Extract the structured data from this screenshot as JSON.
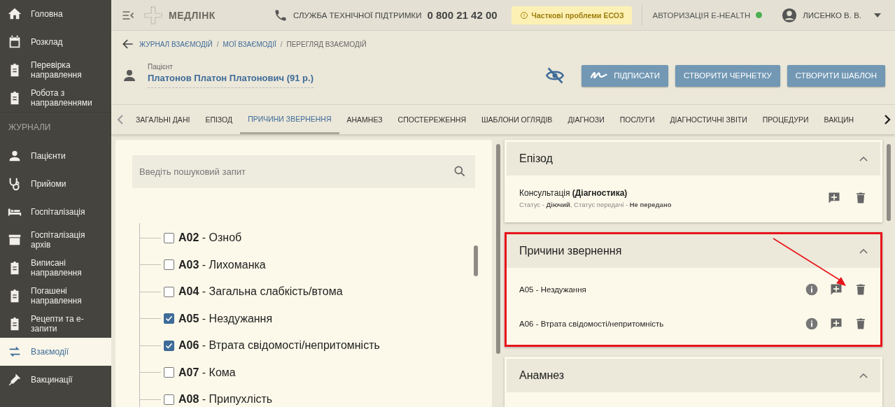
{
  "sidebar": {
    "items": [
      {
        "label": "Головна",
        "selected": false
      },
      {
        "label": "Розклад",
        "selected": false
      },
      {
        "label": "Перевірка направлення",
        "selected": false
      },
      {
        "label": "Робота з направленнями",
        "selected": false
      }
    ],
    "section_title": "ЖУРНАЛИ",
    "journal_items": [
      {
        "label": "Пацієнти",
        "selected": false
      },
      {
        "label": "Прийоми",
        "selected": false
      },
      {
        "label": "Госпіталізація",
        "selected": false
      },
      {
        "label": "Госпіталізація архів",
        "selected": false
      },
      {
        "label": "Виписані направлення",
        "selected": false
      },
      {
        "label": "Погашені направлення",
        "selected": false
      },
      {
        "label": "Рецепти та е-запити",
        "selected": false
      },
      {
        "label": "Взаємодії",
        "selected": true
      },
      {
        "label": "Вакцинації",
        "selected": false
      }
    ]
  },
  "header": {
    "logo": "МЕДЛІНК",
    "support_label": "СЛУЖБА ТЕХНІЧНОЇ ПІДТРИМКИ",
    "support_phone": "0 800 21 42 00",
    "warning": "Часткові проблеми ЕСОЗ",
    "auth_label": "АВТОРИЗАЦІЯ E-HEALTH",
    "user": "ЛИСЕНКО В. В."
  },
  "breadcrumbs": [
    "ЖУРНАЛ ВЗАЄМОДІЙ",
    "МОЇ ВЗАЄМОДІЇ",
    "ПЕРЕГЛЯД ВЗАЄМОДІЙ"
  ],
  "breadcrumb_separator": "/",
  "patient": {
    "label": "Пацієнт",
    "name": "Платонов Платон Платонович (91 р.)"
  },
  "actions": [
    "ПІДПИСАТИ",
    "СТВОРИТИ ЧЕРНЕТКУ",
    "СТВОРИТИ ШАБЛОН"
  ],
  "tabs": [
    {
      "label": "ЗАГАЛЬНІ ДАНІ",
      "selected": false
    },
    {
      "label": "ЕПІЗОД",
      "selected": false
    },
    {
      "label": "ПРИЧИНИ ЗВЕРНЕННЯ",
      "selected": true
    },
    {
      "label": "АНАМНЕЗ",
      "selected": false
    },
    {
      "label": "СПОСТЕРЕЖЕННЯ",
      "selected": false
    },
    {
      "label": "ШАБЛОНИ ОГЛЯДІВ",
      "selected": false
    },
    {
      "label": "ДІАГНОЗИ",
      "selected": false
    },
    {
      "label": "ПОСЛУГИ",
      "selected": false
    },
    {
      "label": "ДІАГНОСТИЧНІ ЗВІТИ",
      "selected": false
    },
    {
      "label": "ПРОЦЕДУРИ",
      "selected": false
    },
    {
      "label": "ВАКЦИН",
      "selected": false
    }
  ],
  "search": {
    "placeholder": "Введіть пошуковий запит"
  },
  "tree": [
    {
      "text": "**A02** - Озноб",
      "checked": false
    },
    {
      "text": "**A03** - Лихоманка",
      "checked": false
    },
    {
      "text": "**A04** - Загальна слабкість/втома",
      "checked": false
    },
    {
      "text": "**A05** - Нездужання",
      "checked": true
    },
    {
      "text": "**A06** - Втрата свідомості/непритомність",
      "checked": true
    },
    {
      "text": "**A07** - Кома",
      "checked": false
    },
    {
      "text": "**A08** - Припухлість",
      "checked": false
    }
  ],
  "episode": {
    "title": "Епізод",
    "name": "Консультація **(Діагностика)**",
    "status": "Статус - **Діючий**, Статус передачі - **Не передано**"
  },
  "reasons": {
    "title": "Причини звернення",
    "highlighted": true,
    "items": [
      "A05 - Нездужання",
      "A06 - Втрата свідомості/непритомність"
    ]
  },
  "anamnesis": {
    "title": "Анамнез"
  }
}
